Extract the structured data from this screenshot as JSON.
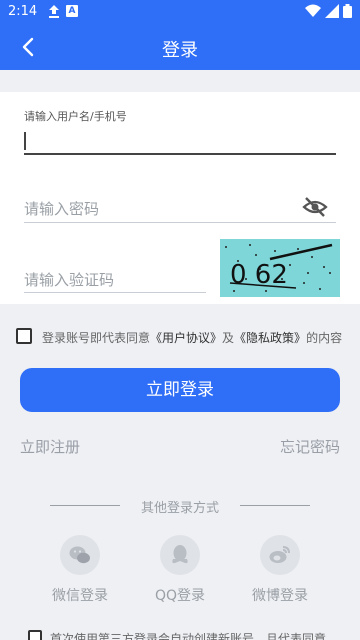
{
  "status_bar": {
    "time": "2:14",
    "notif_letter": "A"
  },
  "app_bar": {
    "title": "登录"
  },
  "form": {
    "username_label": "请输入用户名/手机号",
    "password_placeholder": "请输入密码",
    "captcha_placeholder": "请输入验证码",
    "captcha_text": "0 62"
  },
  "agreement": {
    "prefix": "登录账号即代表同意",
    "user_agreement": "《用户协议》",
    "and": "及",
    "privacy_policy": "《隐私政策》",
    "suffix": "的内容"
  },
  "login_button": "立即登录",
  "register_link": "立即注册",
  "forgot_link": "忘记密码",
  "other_login_label": "其他登录方式",
  "social_logins": [
    {
      "label": "微信登录",
      "icon": "wechat-icon"
    },
    {
      "label": "QQ登录",
      "icon": "qq-icon"
    },
    {
      "label": "微博登录",
      "icon": "weibo-icon"
    }
  ],
  "bottom_notice": "首次使用第三方登录会自动创建新账号，且代表同意",
  "colors": {
    "primary": "#2f6ef6",
    "captcha_bg": "#7fd6d8",
    "page_bg": "#eef0f4"
  }
}
